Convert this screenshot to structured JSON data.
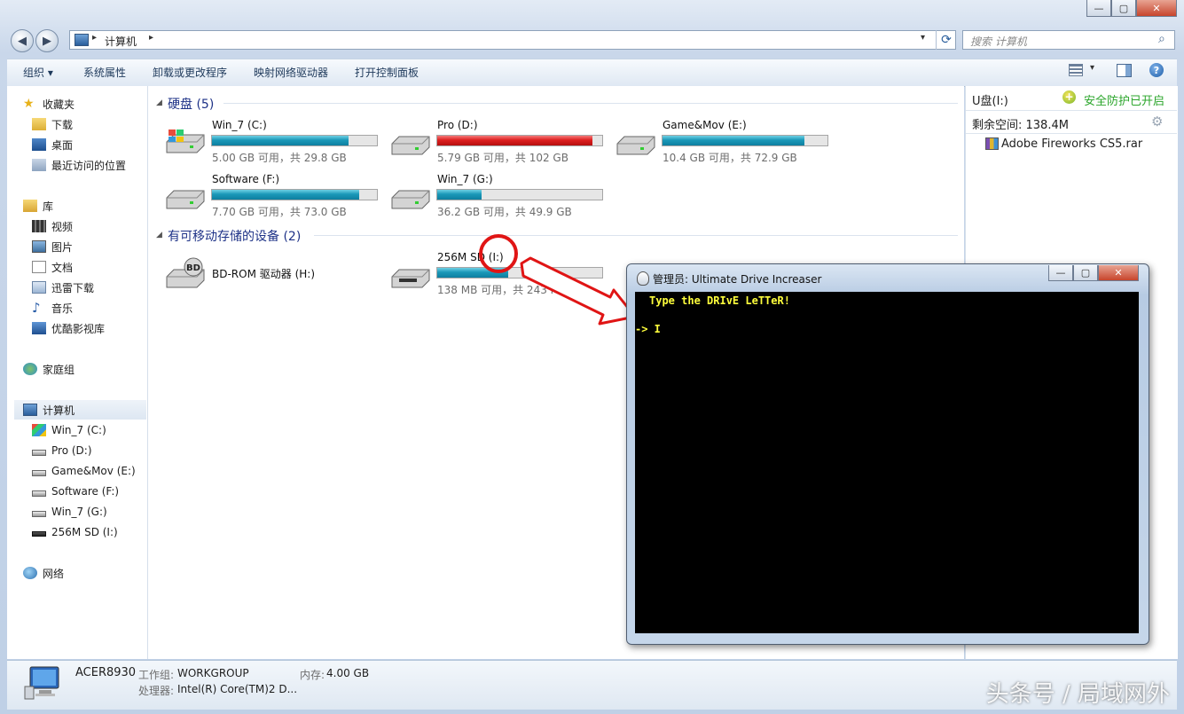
{
  "window": {
    "controls": {
      "minimize": "—",
      "maximize": "▢",
      "close": "✕"
    }
  },
  "address": {
    "path": "计算机",
    "search_placeholder": "搜索 计算机"
  },
  "toolbar": {
    "organize": "组织 ▾",
    "system_properties": "系统属性",
    "uninstall": "卸载或更改程序",
    "map_drive": "映射网络驱动器",
    "control_panel": "打开控制面板"
  },
  "nav": {
    "favorites": "收藏夹",
    "downloads": "下载",
    "desktop": "桌面",
    "recent": "最近访问的位置",
    "libraries": "库",
    "videos": "视频",
    "pictures": "图片",
    "documents": "文档",
    "xunlei": "迅雷下载",
    "music": "音乐",
    "youku": "优酷影视库",
    "homegroup": "家庭组",
    "computer": "计算机",
    "drives": [
      "Win_7 (C:)",
      "Pro (D:)",
      "Game&Mov (E:)",
      "Software (F:)",
      "Win_7 (G:)",
      "256M SD (I:)"
    ],
    "network": "网络"
  },
  "content": {
    "hdd_group": "硬盘 (5)",
    "removable_group": "有可移动存储的设备 (2)",
    "drives": [
      {
        "name": "Win_7 (C:)",
        "info": "5.00 GB 可用，共 29.8 GB",
        "used": 0.83,
        "color": "#1a98b8"
      },
      {
        "name": "Pro (D:)",
        "info": "5.79 GB 可用，共 102 GB",
        "used": 0.94,
        "color": "#dd1f1f"
      },
      {
        "name": "Game&Mov (E:)",
        "info": "10.4 GB 可用，共 72.9 GB",
        "used": 0.86,
        "color": "#1a98b8"
      },
      {
        "name": "Software (F:)",
        "info": "7.70 GB 可用，共 73.0 GB",
        "used": 0.89,
        "color": "#1a98b8"
      },
      {
        "name": "Win_7 (G:)",
        "info": "36.2 GB 可用，共 49.9 GB",
        "used": 0.27,
        "color": "#1a98b8"
      }
    ],
    "bdrom": "BD-ROM 驱动器 (H:)",
    "sd": {
      "name_a": "256M SD",
      "name_b": "(I:)",
      "info": "138 MB 可用，共 243 MB",
      "used": 0.43
    }
  },
  "preview": {
    "drive": "U盘(I:)",
    "protect": "安全防护已开启",
    "free": "剩余空间: 138.4M",
    "file": "Adobe Fireworks CS5.rar"
  },
  "status": {
    "computer_name": "ACER8930",
    "workgroup_label": "工作组:",
    "workgroup": "WORKGROUP",
    "memory_label": "内存:",
    "memory": "4.00 GB",
    "cpu_label": "处理器:",
    "cpu": "Intel(R) Core(TM)2 D..."
  },
  "console": {
    "title": "管理员:  Ultimate Drive Increaser",
    "line1": "Type the DRIvE LeTTeR!",
    "prompt": "-> I"
  },
  "watermark": "头条号 / 局域网外",
  "colors": {
    "accent_arrow": "#e01515",
    "console_text": "#ffff3c"
  }
}
